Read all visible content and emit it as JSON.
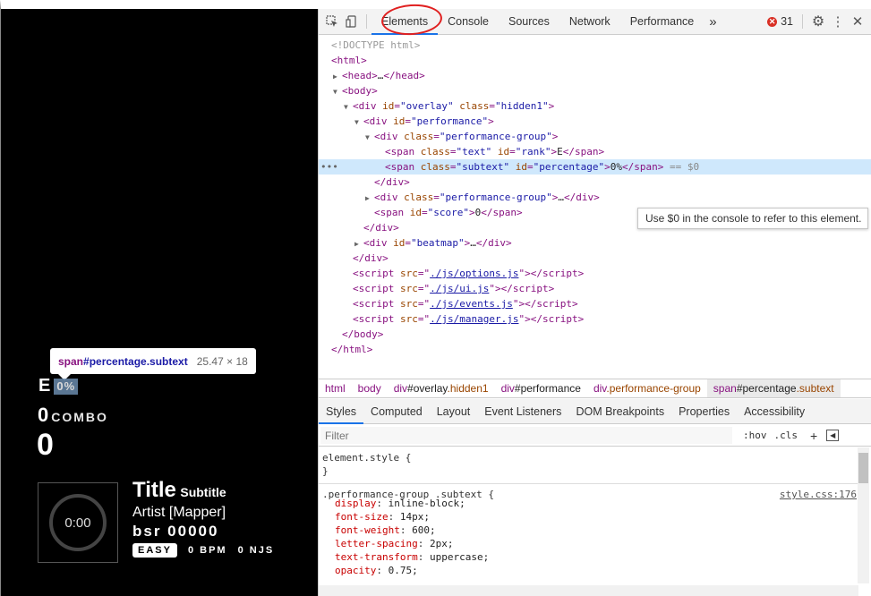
{
  "preview": {
    "tooltip": {
      "tag": "span",
      "selector": "#percentage.subtext",
      "size": "25.47 × 18"
    },
    "rank": "E",
    "percentage": "0%",
    "combo": "0",
    "combo_label": "COMBO",
    "score": "0",
    "time": "0:00",
    "title": "Title",
    "subtitle": "Subtitle",
    "artist": "Artist [Mapper]",
    "bsr": "bsr 00000",
    "difficulty": "EASY",
    "bpm": "0 BPM",
    "njs": "0 NJS"
  },
  "devtools": {
    "tabs": [
      "Elements",
      "Console",
      "Sources",
      "Network",
      "Performance"
    ],
    "more": "»",
    "error_count": "31",
    "hint": "Use $0 in the console to refer to this element.",
    "breadcrumbs": [
      {
        "tag": "html",
        "id": "",
        "cls": ""
      },
      {
        "tag": "body",
        "id": "",
        "cls": ""
      },
      {
        "tag": "div",
        "id": "#overlay",
        "cls": ".hidden1"
      },
      {
        "tag": "div",
        "id": "#performance",
        "cls": ""
      },
      {
        "tag": "div",
        "id": "",
        "cls": ".performance-group"
      },
      {
        "tag": "span",
        "id": "#percentage",
        "cls": ".subtext"
      }
    ],
    "subtabs": [
      "Styles",
      "Computed",
      "Layout",
      "Event Listeners",
      "DOM Breakpoints",
      "Properties",
      "Accessibility"
    ],
    "filter_placeholder": "Filter",
    "hov": ":hov",
    "cls": ".cls",
    "element_style_open": "element.style {",
    "element_style_close": "}",
    "rule_selector": ".performance-group .subtext {",
    "rule_source": "style.css:176",
    "rule_props": [
      {
        "name": "display",
        "value": "inline-block;"
      },
      {
        "name": "font-size",
        "value": "14px;"
      },
      {
        "name": "font-weight",
        "value": "600;"
      },
      {
        "name": "letter-spacing",
        "value": "2px;"
      },
      {
        "name": "text-transform",
        "value": "uppercase;"
      },
      {
        "name": "opacity",
        "value": "0.75;"
      }
    ],
    "dom": {
      "doctype": "<!DOCTYPE html>",
      "script_srcs": [
        "./js/options.js",
        "./js/ui.js",
        "./js/events.js",
        "./js/manager.js"
      ],
      "eq0": "== $0",
      "rank_text": "E",
      "pct_text": "0%",
      "score_text": "0",
      "ellipsis": "…"
    }
  }
}
